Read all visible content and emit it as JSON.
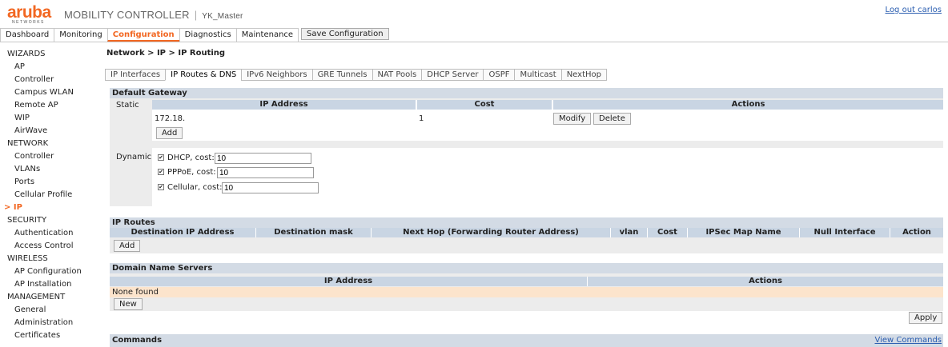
{
  "header": {
    "logo_word": "aruba",
    "logo_sub": "NETWORKS",
    "product": "MOBILITY CONTROLLER",
    "separator": "|",
    "hostname": "YK_Master",
    "logout": "Log out carlos"
  },
  "topnav": {
    "tabs": [
      "Dashboard",
      "Monitoring",
      "Configuration",
      "Diagnostics",
      "Maintenance"
    ],
    "active": "Configuration",
    "save_label": "Save Configuration"
  },
  "sidebar": {
    "wizards": {
      "title": "WIZARDS",
      "items": [
        "AP",
        "Controller",
        "Campus WLAN",
        "Remote AP",
        "WIP",
        "AirWave"
      ]
    },
    "network": {
      "title": "NETWORK",
      "items": [
        "Controller",
        "VLANs",
        "Ports",
        "Cellular Profile",
        "IP"
      ]
    },
    "security": {
      "title": "SECURITY",
      "items": [
        "Authentication",
        "Access Control"
      ]
    },
    "wireless": {
      "title": "WIRELESS",
      "items": [
        "AP Configuration",
        "AP Installation"
      ]
    },
    "management": {
      "title": "MANAGEMENT",
      "items": [
        "General",
        "Administration",
        "Certificates"
      ]
    },
    "active_marker": ">"
  },
  "breadcrumb": "Network > IP > IP Routing",
  "subtabs": [
    "IP Interfaces",
    "IP Routes & DNS",
    "IPv6 Neighbors",
    "GRE Tunnels",
    "NAT Pools",
    "DHCP Server",
    "OSPF",
    "Multicast",
    "NextHop"
  ],
  "default_gateway": {
    "title": "Default Gateway",
    "static_label": "Static",
    "columns": [
      "IP Address",
      "Cost",
      "Actions"
    ],
    "row": {
      "ip": "172.18.",
      "cost": "1",
      "modify": "Modify",
      "delete": "Delete"
    },
    "add": "Add",
    "dynamic_label": "Dynamic",
    "dynamic": [
      {
        "label": "DHCP,  cost:",
        "value": "10",
        "checked": true
      },
      {
        "label": "PPPoE,  cost:",
        "value": "10",
        "checked": true
      },
      {
        "label": "Cellular,  cost:",
        "value": "10",
        "checked": true
      }
    ]
  },
  "ip_routes": {
    "title": "IP Routes",
    "columns": [
      "Destination IP Address",
      "Destination mask",
      "Next Hop (Forwarding Router Address)",
      "vlan",
      "Cost",
      "IPSec Map Name",
      "Null Interface",
      "Action"
    ],
    "add": "Add"
  },
  "dns": {
    "title": "Domain Name Servers",
    "columns": [
      "IP Address",
      "Actions"
    ],
    "empty": "None found",
    "new": "New"
  },
  "apply": "Apply",
  "commands": {
    "title": "Commands",
    "link": "View Commands"
  },
  "colors": {
    "brand": "#f26722",
    "panel": "#ececec",
    "header": "#c9d5e3",
    "empty_row": "#fce4cc",
    "link": "#2a5db0"
  }
}
